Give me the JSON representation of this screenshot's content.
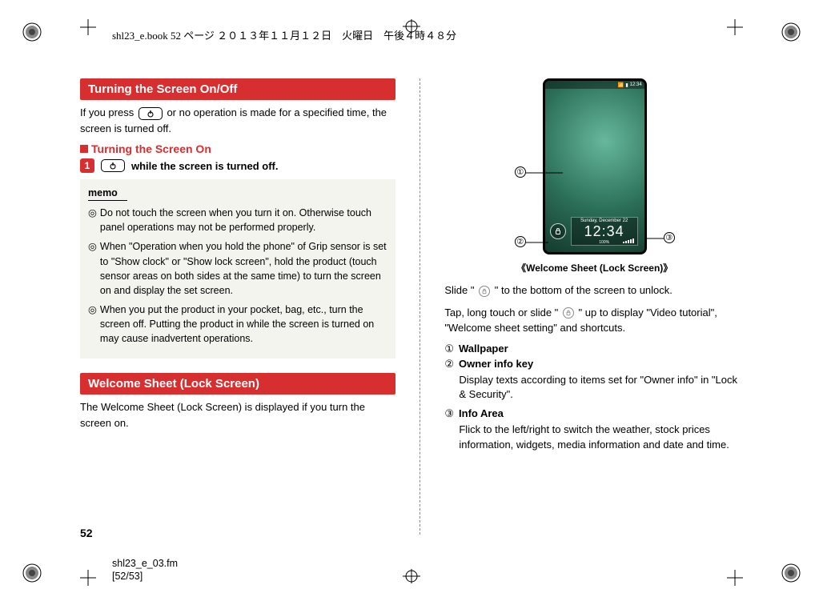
{
  "running_header": "shl23_e.book  52 ページ  ２０１３年１１月１２日　火曜日　午後４時４８分",
  "running_footer_line1": "shl23_e_03.fm",
  "running_footer_line2": "[52/53]",
  "page_number": "52",
  "left": {
    "heading1": "Turning the Screen On/Off",
    "intro_a": "If you press ",
    "intro_b": " or no operation is made for a specified time, the screen is turned off.",
    "subhead": "Turning the Screen On",
    "step_badge": "1",
    "step_text": " while the screen is turned off.",
    "memo_title": "memo",
    "memo1": "Do not touch the screen when you turn it on. Otherwise touch panel operations may not be performed properly.",
    "memo2": "When \"Operation when you hold the phone\" of Grip sensor is set to \"Show clock\" or \"Show lock screen\", hold the product (touch sensor areas on both sides at the same time) to turn the screen on and display the set screen.",
    "memo3": "When you put the product in your pocket, bag, etc., turn the screen off. Putting the product in while the screen is turned on may cause inadvertent operations.",
    "heading2": "Welcome Sheet (Lock Screen)",
    "welcome_intro": "The Welcome Sheet (Lock Screen) is displayed if you turn the screen on."
  },
  "right": {
    "status_time": "12:34",
    "info_day": "Sunday, December 22",
    "info_clock": "12:34",
    "info_batt": "100%",
    "fig_caption": "《Welcome Sheet (Lock Screen)》",
    "slide_a": "Slide \"",
    "slide_b": "\" to the bottom of the screen to unlock.",
    "tap_a": "Tap, long touch or slide \"",
    "tap_b": "\" up to display \"Video tutorial\", \"Welcome sheet setting\" and shortcuts.",
    "c1": "①",
    "c2": "②",
    "c3": "③",
    "d1_label": "Wallpaper",
    "d2_label": "Owner info key",
    "d2_desc": "Display texts according to items set for \"Owner info\" in \"Lock & Security\".",
    "d3_label": "Info Area",
    "d3_desc": "Flick to the left/right to switch the weather, stock prices information, widgets, media information and date and time."
  }
}
